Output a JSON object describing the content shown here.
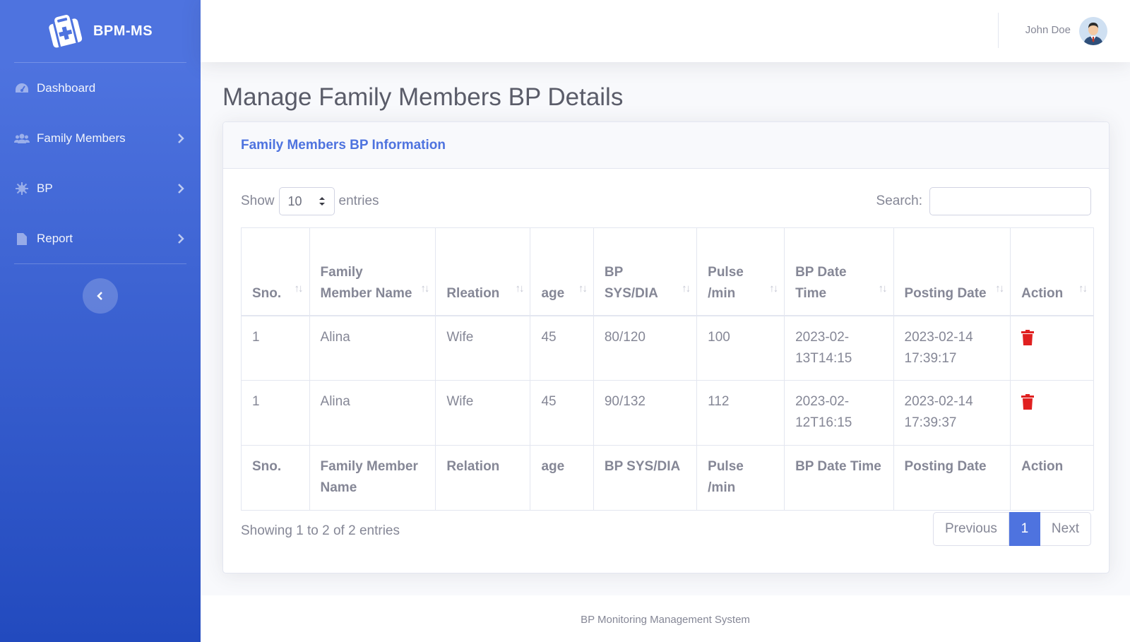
{
  "sidebar": {
    "brand": "BPM-MS",
    "items": [
      {
        "label": "Dashboard",
        "icon": "dashboard-gauge-icon",
        "has_submenu": false
      },
      {
        "label": "Family Members",
        "icon": "users-icon",
        "has_submenu": true
      },
      {
        "label": "BP",
        "icon": "virus-icon",
        "has_submenu": true
      },
      {
        "label": "Report",
        "icon": "file-icon",
        "has_submenu": true
      }
    ]
  },
  "topbar": {
    "user_name": "John Doe"
  },
  "page": {
    "title": "Manage Family Members BP Details"
  },
  "card": {
    "title": "Family Members BP Information",
    "show_label": "Show",
    "entries_value": "10",
    "entries_label": "entries",
    "search_label": "Search:",
    "search_value": ""
  },
  "table": {
    "headers": [
      "Sno.",
      "Family Member Name",
      "Rleation",
      "age",
      "BP SYS/DIA",
      "Pulse /min",
      "BP Date Time",
      "Posting Date",
      "Action"
    ],
    "footer_headers": [
      "Sno.",
      "Family Member Name",
      "Relation",
      "age",
      "BP SYS/DIA",
      "Pulse /min",
      "BP Date Time",
      "Posting Date",
      "Action"
    ],
    "rows": [
      {
        "sno": "1",
        "name": "Alina",
        "relation": "Wife",
        "age": "45",
        "bp": "80/120",
        "pulse": "100",
        "bp_date": "2023-02-13T14:15",
        "posting_date": "2023-02-14 17:39:17"
      },
      {
        "sno": "1",
        "name": "Alina",
        "relation": "Wife",
        "age": "45",
        "bp": "90/132",
        "pulse": "112",
        "bp_date": "2023-02-12T16:15",
        "posting_date": "2023-02-14 17:39:37"
      }
    ]
  },
  "pagination": {
    "info": "Showing 1 to 2 of 2 entries",
    "previous": "Previous",
    "current": "1",
    "next": "Next"
  },
  "footer": {
    "text": "BP Monitoring Management System"
  },
  "colors": {
    "primary": "#4e73df",
    "danger": "#e02020",
    "text": "#858796"
  }
}
